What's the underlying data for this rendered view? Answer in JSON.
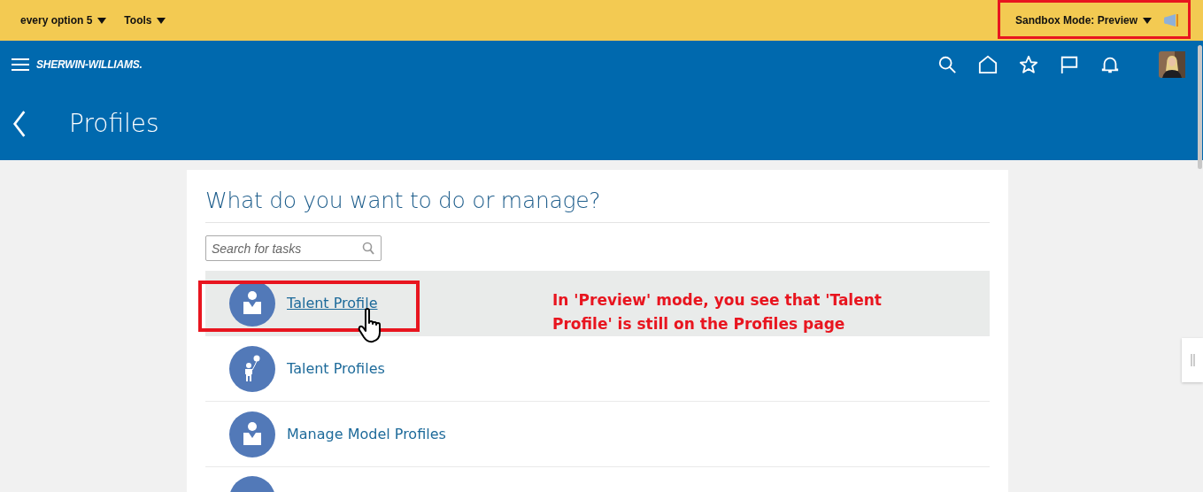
{
  "top_bar": {
    "menus": [
      {
        "label": "every option 5"
      },
      {
        "label": "Tools"
      }
    ],
    "sandbox": {
      "label": "Sandbox Mode: Preview"
    }
  },
  "header": {
    "logo": "SHERWIN-WILLIAMS.",
    "page_title": "Profiles"
  },
  "card": {
    "heading": "What do you want to do or manage?",
    "search": {
      "placeholder": "Search for tasks"
    },
    "tasks": [
      {
        "label": "Talent Profile",
        "kind": "person",
        "selected": true
      },
      {
        "label": "Talent Profiles",
        "kind": "child",
        "selected": false
      },
      {
        "label": "Manage Model Profiles",
        "kind": "person",
        "selected": false
      }
    ]
  },
  "annotation": {
    "text": "In 'Preview' mode, you see that 'Talent Profile' is still on the Profiles page"
  }
}
